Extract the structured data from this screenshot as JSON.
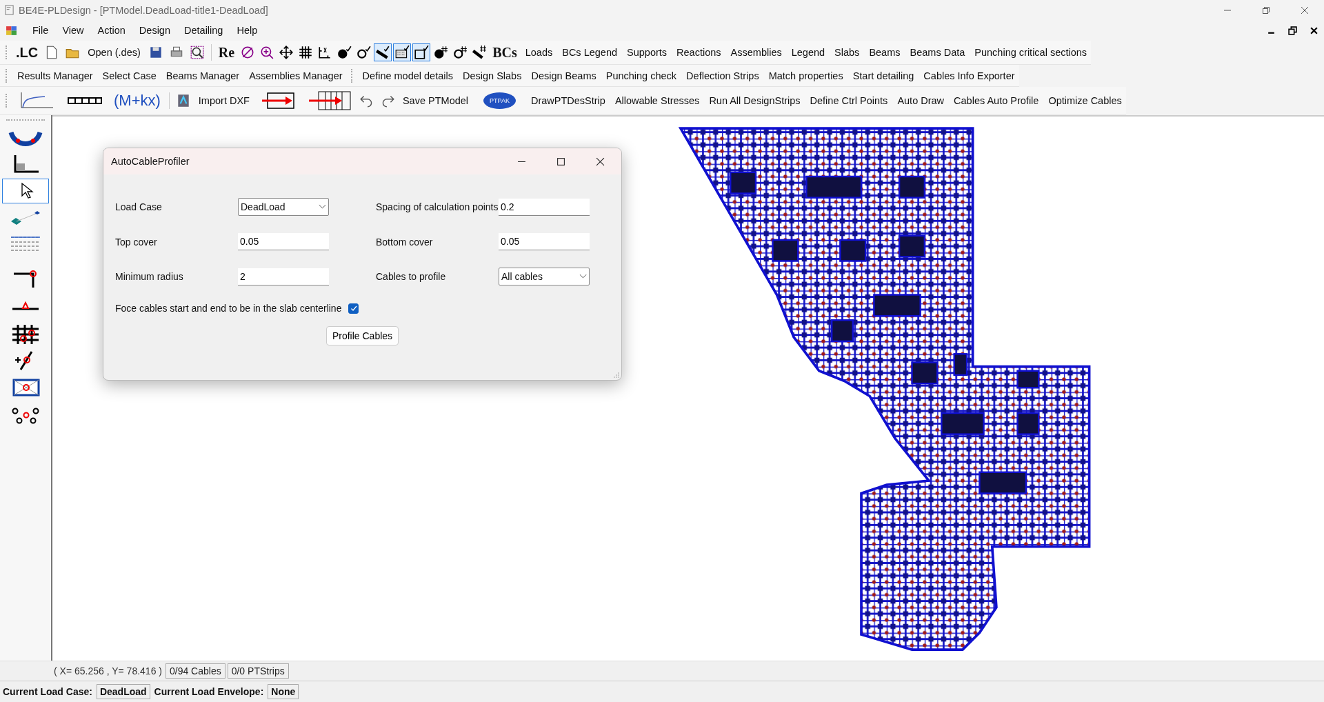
{
  "window": {
    "title": "BE4E-PLDesign - [PTModel.DeadLoad-title1-DeadLoad]"
  },
  "menu": [
    "File",
    "View",
    "Action",
    "Design",
    "Detailing",
    "Help"
  ],
  "toolbar_1": {
    "lc_label": ".LC",
    "open_label": "Open (.des)",
    "re_label": "Re",
    "view_toggles": [
      {
        "pressed": false
      },
      {
        "pressed": false
      },
      {
        "pressed": false
      },
      {
        "pressed": false
      },
      {
        "pressed": false
      },
      {
        "pressed": false
      },
      {
        "pressed": false
      },
      {
        "pressed": true
      },
      {
        "pressed": true
      },
      {
        "pressed": true
      },
      {
        "pressed": false
      },
      {
        "pressed": false
      },
      {
        "pressed": false
      }
    ],
    "bcs_label": "BCs",
    "buttons": [
      "Loads",
      "BCs Legend",
      "Supports",
      "Reactions",
      "Assemblies",
      "Legend",
      "Slabs",
      "Beams",
      "Beams Data",
      "Punching critical sections"
    ]
  },
  "toolbar_2": {
    "group_1": [
      "Results Manager",
      "Select Case",
      "Beams Manager",
      "Assemblies Manager"
    ],
    "group_2": [
      "Define model details",
      "Design Slabs",
      "Design Beams",
      "Punching check",
      "Deflection Strips",
      "Match properties",
      "Start detailing",
      "Cables Info Exporter"
    ]
  },
  "toolbar_3": {
    "formula_label": "(M+kx)",
    "import_label": "Import DXF",
    "save_label": "Save PTModel",
    "badge_label": "PTPAK",
    "buttons": [
      "DrawPTDesStrip",
      "Allowable Stresses",
      "Run All DesignStrips",
      "Define Ctrl Points",
      "Auto Draw",
      "Cables Auto Profile",
      "Optimize Cables"
    ]
  },
  "left_tools": [
    {
      "selected": false
    },
    {
      "selected": false
    },
    {
      "selected": true
    },
    {
      "selected": false
    },
    {
      "selected": false
    },
    {
      "selected": false
    },
    {
      "selected": false
    },
    {
      "selected": false
    },
    {
      "selected": false
    },
    {
      "selected": false
    },
    {
      "selected": false
    }
  ],
  "dialog": {
    "title": "AutoCableProfiler",
    "fields": [
      {
        "label": "Load Case",
        "kind": "dropdown",
        "value": "DeadLoad"
      },
      {
        "label": "Spacing of calculation points",
        "kind": "text",
        "value": "0.2"
      },
      {
        "label": "Top cover",
        "kind": "text",
        "value": "0.05"
      },
      {
        "label": "Bottom cover",
        "kind": "text",
        "value": "0.05"
      },
      {
        "label": "Minimum radius",
        "kind": "text",
        "value": "2"
      },
      {
        "label": "Cables to profile",
        "kind": "dropdown",
        "value": "All cables"
      }
    ],
    "checkbox": {
      "label": "Foce cables start and end to be in the slab centerline",
      "checked": true
    },
    "button": "Profile Cables"
  },
  "status_bar": {
    "coordinates": "( X= 65.256 , Y= 78.416 )",
    "cables": "0/94 Cables",
    "strips": "0/0 PTStrips",
    "load_case_label": "Current Load Case:",
    "load_case": "DeadLoad",
    "envelope_label": "Current Load Envelope:",
    "envelope": "None"
  }
}
